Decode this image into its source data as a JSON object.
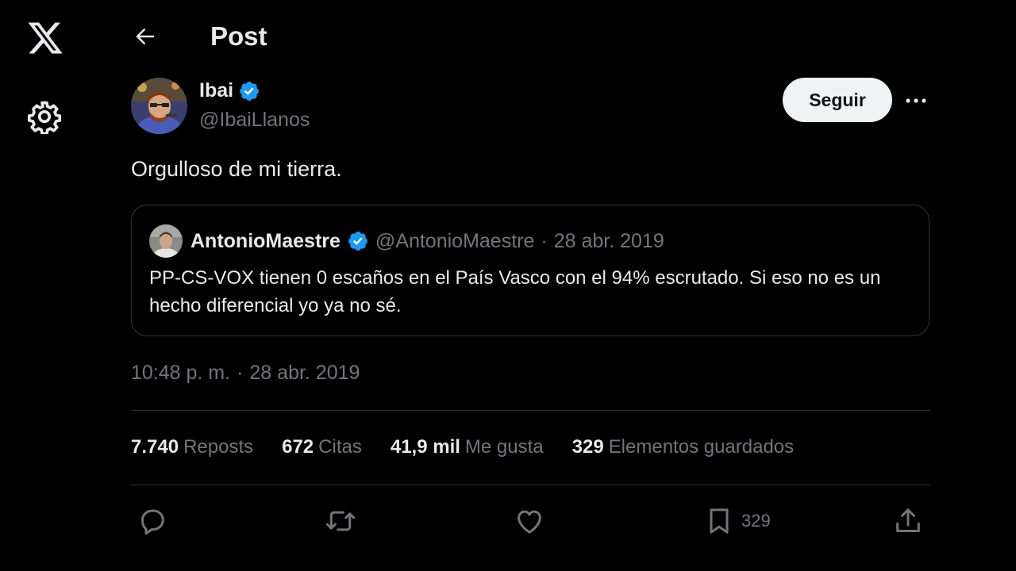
{
  "header": {
    "title": "Post"
  },
  "tweet": {
    "author": {
      "name": "Ibai",
      "handle": "@IbaiLlanos",
      "verified": true
    },
    "follow_label": "Seguir",
    "text": "Orgulloso de mi tierra.",
    "quote": {
      "name": "AntonioMaestre",
      "handle": "@AntonioMaestre",
      "separator": "·",
      "date": "28 abr. 2019",
      "verified": true,
      "text": "PP-CS-VOX tienen 0 escaños en el País Vasco con el 94% escrutado. Si eso no es un hecho diferencial yo ya no sé."
    },
    "timestamp": {
      "time": "10:48 p. m.",
      "separator": "·",
      "date": "28 abr. 2019"
    },
    "stats": [
      {
        "value": "7.740",
        "label": "Reposts"
      },
      {
        "value": "672",
        "label": "Citas"
      },
      {
        "value": "41,9 mil",
        "label": "Me gusta"
      },
      {
        "value": "329",
        "label": "Elementos guardados"
      }
    ],
    "actions": {
      "bookmark_count": "329"
    }
  },
  "icons": {
    "logo": "x-logo-icon",
    "settings": "gear-icon",
    "back": "arrow-left-icon",
    "more": "ellipsis-icon",
    "verified": "verified-badge-icon",
    "reply": "reply-icon",
    "repost": "repost-icon",
    "like": "heart-icon",
    "bookmark": "bookmark-icon",
    "share": "share-icon"
  },
  "colors": {
    "background": "#000000",
    "text_primary": "#e7e9ea",
    "text_secondary": "#71767b",
    "verified_blue": "#1d9bf0",
    "border": "#2f3336",
    "follow_bg": "#eff3f4"
  }
}
